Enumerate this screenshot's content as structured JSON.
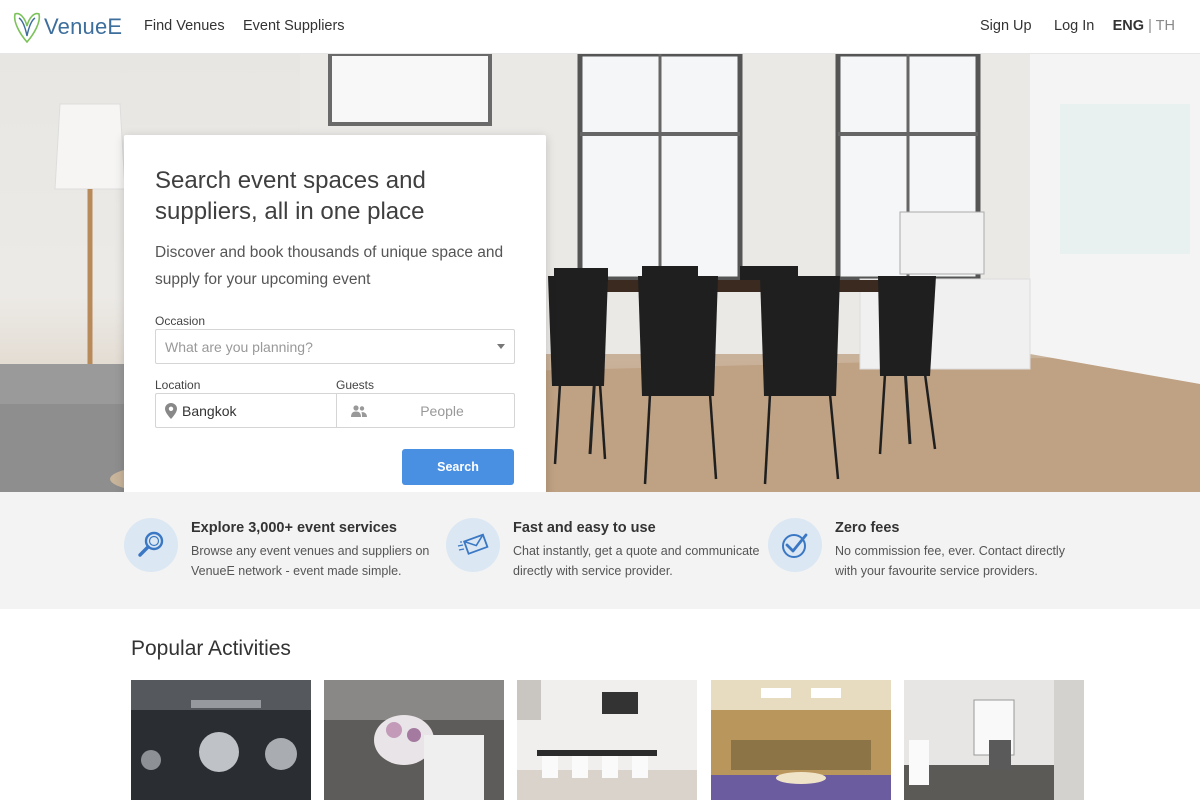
{
  "header": {
    "logo_text": "VenueE",
    "nav": [
      "Find Venues",
      "Event Suppliers"
    ],
    "sign_up": "Sign Up",
    "log_in": "Log In",
    "lang_active": "ENG",
    "lang_separator": "|",
    "lang_other": "TH"
  },
  "search_card": {
    "title": "Search event spaces and suppliers, all in one place",
    "subtitle": "Discover and book thousands of unique space and supply for your upcoming event",
    "occasion_label": "Occasion",
    "occasion_placeholder": "What are you planning?",
    "location_label": "Location",
    "location_value": "Bangkok",
    "guests_label": "Guests",
    "guests_placeholder": "People",
    "search_button": "Search"
  },
  "features": [
    {
      "title": "Explore 3,000+ event services",
      "desc": "Browse any event venues and suppliers on VenueE network - event made simple.",
      "icon": "magnifier-icon"
    },
    {
      "title": "Fast and easy to use",
      "desc": "Chat instantly, get a quote and communicate directly with service provider.",
      "icon": "envelope-icon"
    },
    {
      "title": "Zero fees",
      "desc": "No commission fee, ever. Contact directly with your favourite service providers.",
      "icon": "checkmark-icon"
    }
  ],
  "popular": {
    "title": "Popular Activities",
    "cards": [
      "party",
      "wedding",
      "meeting-room",
      "auditorium",
      "interior-room"
    ]
  },
  "colors": {
    "brand_blue": "#3d6e9c",
    "brand_green": "#7cc25a",
    "button_blue": "#4a90e2",
    "feature_bg": "#f3f3f3",
    "icon_circle": "#dbe7f3"
  }
}
